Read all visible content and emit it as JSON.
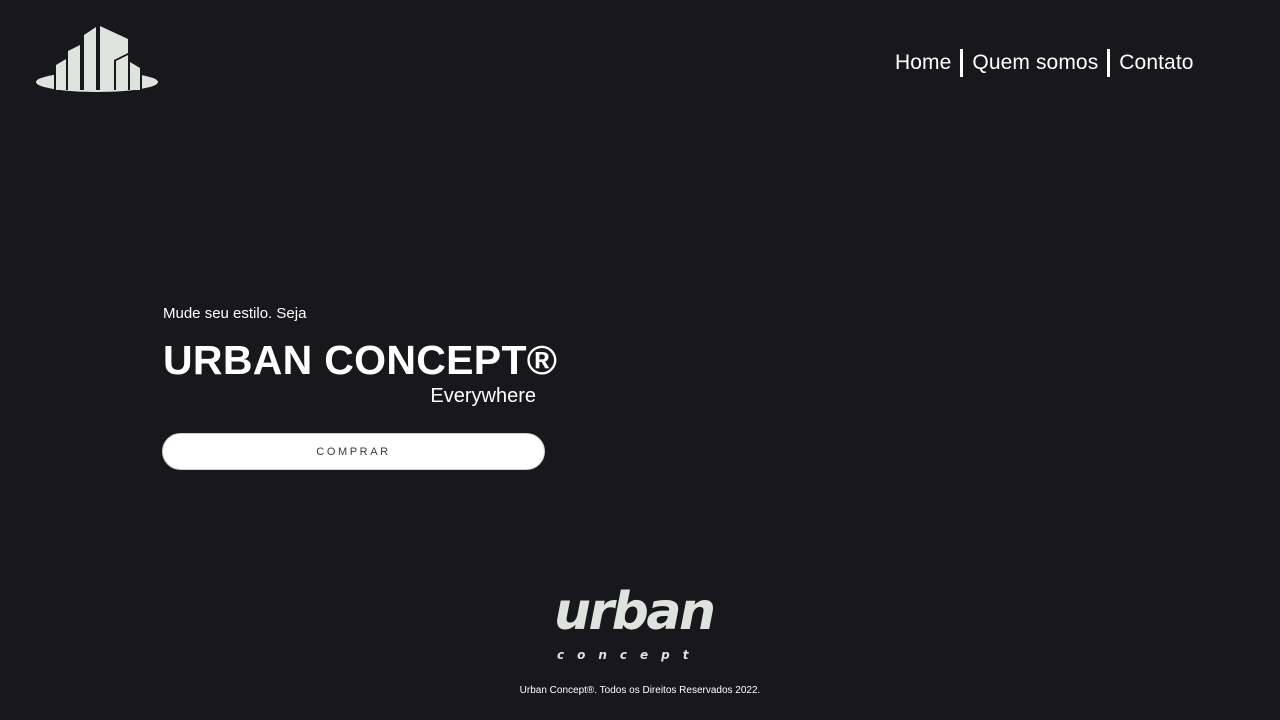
{
  "header": {
    "logo_icon": "city-buildings-icon",
    "nav": {
      "home": "Home",
      "about": "Quem somos",
      "contact": "Contato"
    }
  },
  "hero": {
    "kicker": "Mude seu estilo. Seja",
    "title": "URBAN CONCEPT®",
    "subtitle": "Everywhere",
    "button_label": "COMPRAR"
  },
  "footer": {
    "brand_word": "urban",
    "brand_sub": "concept",
    "copyright": "Urban Concept®. Todos os Direitos Reservados 2022."
  },
  "colors": {
    "background": "#18171c",
    "text": "#ffffff",
    "logo": "#dfe3dd",
    "button_bg": "#ffffff",
    "button_text": "#3a3940"
  }
}
